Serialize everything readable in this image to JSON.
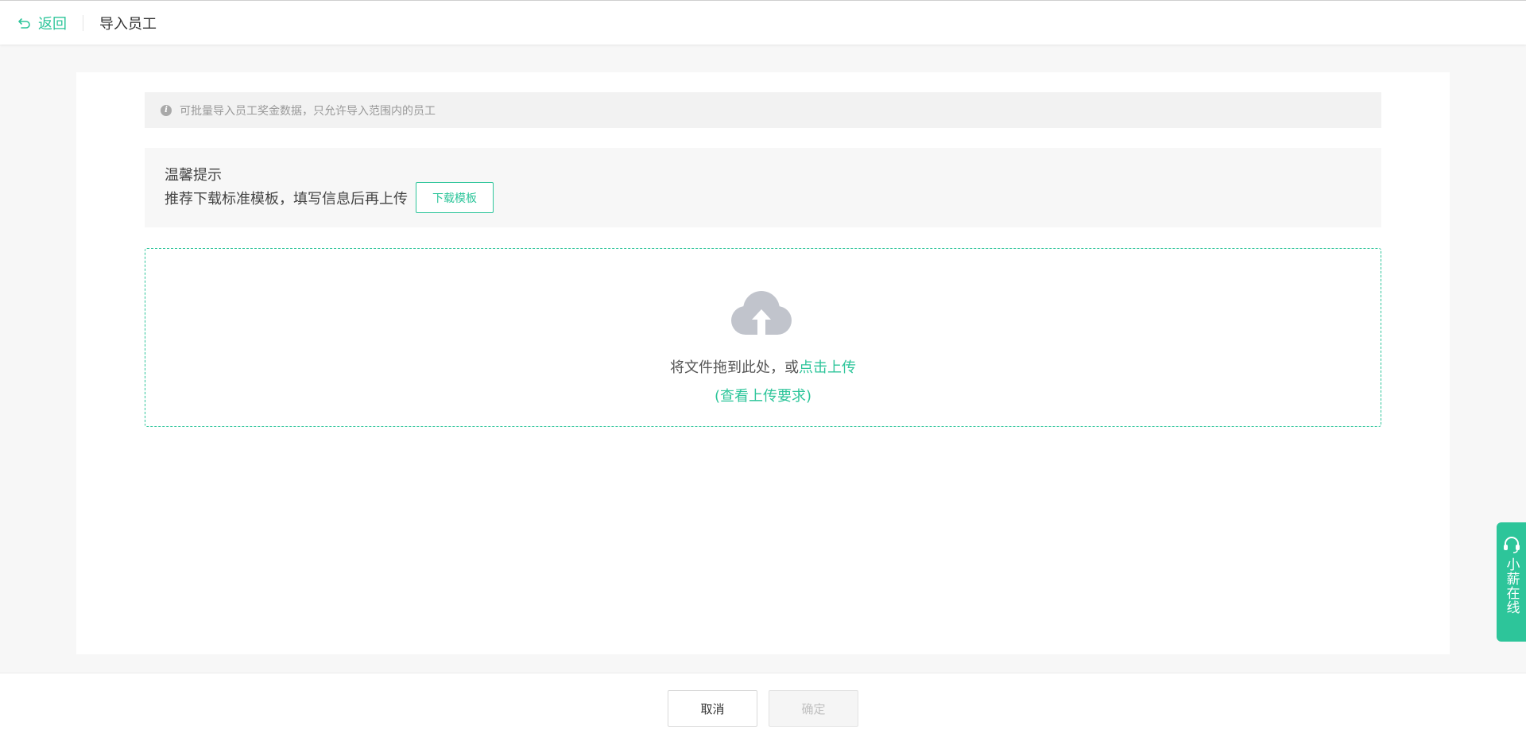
{
  "header": {
    "back_label": "返回",
    "title": "导入员工"
  },
  "info_bar": {
    "text": "可批量导入员工奖金数据，只允许导入范围内的员工"
  },
  "tips": {
    "title": "温馨提示",
    "text": "推荐下载标准模板，填写信息后再上传",
    "download_label": "下载模板"
  },
  "upload": {
    "drag_text": "将文件拖到此处，或",
    "click_text": "点击上传",
    "requirements_text": "(查看上传要求)"
  },
  "footer": {
    "cancel_label": "取消",
    "confirm_label": "确定"
  },
  "chat_widget": {
    "label": "小薪在线"
  },
  "colors": {
    "accent": "#2dc59a",
    "cloud": "#c1c4cc"
  }
}
